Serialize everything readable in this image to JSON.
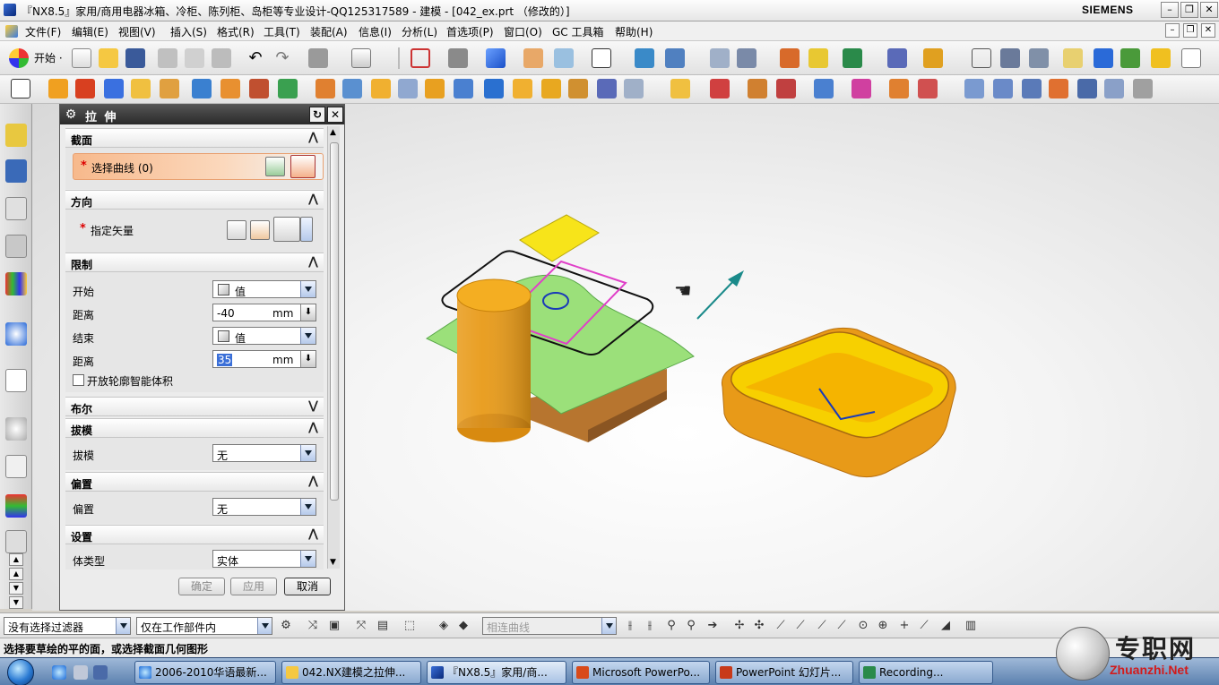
{
  "window": {
    "title": "『NX8.5』家用/商用电器冰箱、冷柜、陈列柜、岛柜等专业设计-QQ125317589 - 建模 - [042_ex.prt （修改的）]",
    "brand": "SIEMENS"
  },
  "menu": [
    "文件(F)",
    "编辑(E)",
    "视图(V)",
    "插入(S)",
    "格式(R)",
    "工具(T)",
    "装配(A)",
    "信息(I)",
    "分析(L)",
    "首选项(P)",
    "窗口(O)",
    "GC 工具箱",
    "帮助(H)"
  ],
  "toolbar": {
    "start_label": "开始 ·"
  },
  "dialog": {
    "title": "拉 伸",
    "sections": {
      "section": "截面",
      "direction": "方向",
      "limits": "限制",
      "boolean": "布尔",
      "draft": "拔模",
      "offset": "偏置",
      "settings": "设置"
    },
    "select_curve": "选择曲线 (0)",
    "specify_vector": "指定矢量",
    "start_label": "开始",
    "start_value": "值",
    "distance1_label": "距离",
    "distance1_value": "-40",
    "unit": "mm",
    "end_label": "结束",
    "end_value": "值",
    "distance2_label": "距离",
    "distance2_value": "35",
    "open_profile_label": "开放轮廓智能体积",
    "draft_label": "拔模",
    "draft_value": "无",
    "offset_label": "偏置",
    "offset_value": "无",
    "body_type_label": "体类型",
    "body_type_value": "实体",
    "ok": "确定",
    "apply": "应用",
    "cancel": "取消"
  },
  "selection_bar": {
    "filter": "没有选择过滤器",
    "scope": "仅在工作部件内",
    "curve_rule": "相连曲线"
  },
  "status": "选择要草绘的平的面，或选择截面几何图形",
  "taskbar": {
    "tasks": [
      "2006-2010华语最新...",
      "042.NX建模之拉伸...",
      "『NX8.5』家用/商...",
      "Microsoft PowerPo...",
      "PowerPoint 幻灯片...",
      "Recording..."
    ]
  },
  "watermark": {
    "text": "专职网",
    "sub": "Zhuanzhi.Net"
  },
  "colors": {
    "orange_body": "#f2a31a",
    "yellow_face": "#f7e41a",
    "green_sheet": "#9be07a",
    "magenta_rect": "#e040c8",
    "vector_arrow": "#1a8a8a"
  }
}
